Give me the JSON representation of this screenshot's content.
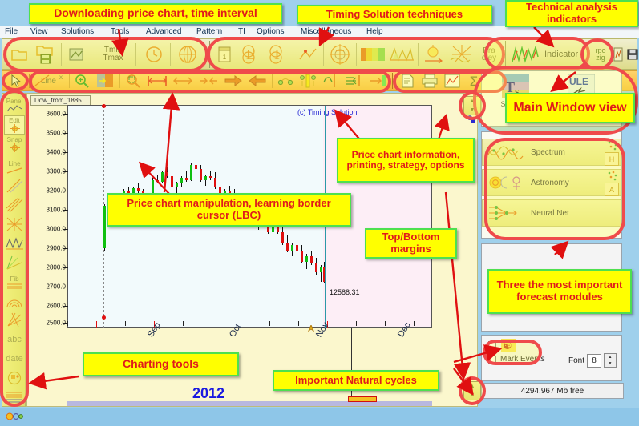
{
  "menu": {
    "items": [
      "File",
      "View",
      "Solutions",
      "Tools",
      "Advanced",
      "Pattern",
      "TI",
      "Options",
      "Miscellaneous",
      "Help"
    ]
  },
  "toolbar_main": {
    "buttons": [
      {
        "name": "open-chart",
        "icon": "folder-open-icon",
        "label": ""
      },
      {
        "name": "save-chart",
        "icon": "folder-save-icon",
        "label": ""
      },
      {
        "name": "export-icon",
        "icon": "export-icon",
        "label": ""
      },
      {
        "name": "time-interval",
        "icon": "tmin-tmax-icon",
        "label": "Tmin\nTmax"
      },
      {
        "name": "clock",
        "icon": "clock-icon",
        "label": ""
      },
      {
        "name": "globe",
        "icon": "globe-icon",
        "label": ""
      },
      {
        "name": "calendar",
        "icon": "calendar-icon",
        "label": ""
      },
      {
        "name": "overlap-e",
        "icon": "ellipse-e-icon",
        "label": ""
      },
      {
        "name": "overlap-t",
        "icon": "ellipse-t-icon",
        "label": ""
      },
      {
        "name": "scatter",
        "icon": "scatter-icon",
        "label": ""
      },
      {
        "name": "astro-wheel",
        "icon": "astro-wheel-icon",
        "label": ""
      },
      {
        "name": "color-bars",
        "icon": "color-bars-icon",
        "label": ""
      },
      {
        "name": "triangles",
        "icon": "triangle-wave-icon",
        "label": ""
      },
      {
        "name": "sun-arrow",
        "icon": "sun-arrow-icon",
        "label": ""
      },
      {
        "name": "star-burst",
        "icon": "star-burst-icon",
        "label": ""
      },
      {
        "name": "bradley",
        "icon": "bradley-icon",
        "label": "Bra\ndley"
      },
      {
        "name": "indicator",
        "icon": "indicator-icon",
        "label": "Indicator"
      },
      {
        "name": "rpo-zig",
        "icon": "zigzag-icon",
        "label": "rpo\nzig"
      },
      {
        "name": "composite",
        "icon": "composite-icon",
        "label": ""
      },
      {
        "name": "save-disk",
        "icon": "floppy-disk-icon",
        "label": ""
      }
    ]
  },
  "toolbar_chart": {
    "buttons": [
      {
        "name": "cursor-tool",
        "icon": "arrow-cursor-icon",
        "label": ""
      },
      {
        "name": "line-tool",
        "icon": "line-icon",
        "label": "Line"
      },
      {
        "name": "zoom-in",
        "icon": "magnifier-plus-icon",
        "label": ""
      },
      {
        "name": "border-cursor",
        "icon": "lbc-icon",
        "label": ""
      },
      {
        "name": "zoom-region",
        "icon": "magnifier-region-icon",
        "label": ""
      },
      {
        "name": "fit-width",
        "icon": "span-arrows-icon",
        "label": ""
      },
      {
        "name": "expand-x",
        "icon": "expand-arrows-icon",
        "label": ""
      },
      {
        "name": "shrink-x",
        "icon": "shrink-arrows-icon",
        "label": ""
      },
      {
        "name": "scroll-right",
        "icon": "arrow-right-icon",
        "label": ""
      },
      {
        "name": "scroll-left",
        "icon": "arrow-left-icon",
        "label": ""
      },
      {
        "name": "two-dots",
        "icon": "two-dots-icon",
        "label": ""
      },
      {
        "name": "split-view",
        "icon": "split-view-icon",
        "label": ""
      },
      {
        "name": "drag-edge",
        "icon": "hand-edge-icon",
        "label": ""
      },
      {
        "name": "snap-left",
        "icon": "snap-left-icon",
        "label": ""
      },
      {
        "name": "snap-right",
        "icon": "snap-right-icon",
        "label": ""
      },
      {
        "name": "chart-info",
        "icon": "document-icon",
        "label": ""
      },
      {
        "name": "print-chart",
        "icon": "printer-icon",
        "label": ""
      },
      {
        "name": "strategy",
        "icon": "strategy-chart-icon",
        "label": ""
      },
      {
        "name": "sum-options",
        "icon": "sigma-icon",
        "label": ""
      },
      {
        "name": "options-gear",
        "icon": "gear-icon",
        "label": ""
      }
    ]
  },
  "toolbar_left": {
    "buttons": [
      {
        "name": "panel-tool",
        "label": "Panel",
        "icon": "panel-icon"
      },
      {
        "name": "edit-tool",
        "label": "Edit",
        "icon": "edit-crosshair-icon"
      },
      {
        "name": "snap-tool",
        "label": "Snap",
        "icon": "snap-magnet-icon"
      },
      {
        "name": "line-tool",
        "label": "Line",
        "icon": "trend-line-icon"
      },
      {
        "name": "parallel-lines-tool",
        "label": "",
        "icon": "parallel-lines-icon"
      },
      {
        "name": "channel-tool",
        "label": "",
        "icon": "channel-icon"
      },
      {
        "name": "grid-tool",
        "label": "",
        "icon": "grid-lines-icon"
      },
      {
        "name": "zigzag-tool",
        "label": "",
        "icon": "zigzag-wave-icon"
      },
      {
        "name": "fan-tool",
        "label": "",
        "icon": "fan-lines-icon"
      },
      {
        "name": "fib-tool",
        "label": "Fib",
        "icon": "fibonacci-icon"
      },
      {
        "name": "fib-arc-tool",
        "label": "",
        "icon": "fib-arc-icon"
      },
      {
        "name": "fib-fan-tool",
        "label": "",
        "icon": "fib-fan-icon"
      },
      {
        "name": "text-tool",
        "label": "abc",
        "icon": "text-icon"
      },
      {
        "name": "date-tool",
        "label": "date",
        "icon": "date-icon"
      },
      {
        "name": "astro-tool",
        "label": "",
        "icon": "astro-face-icon"
      },
      {
        "name": "horizontal-lines-tool",
        "label": "",
        "icon": "horizontal-lines-icon"
      },
      {
        "name": "planet-tool",
        "label": "",
        "icon": "planets-icon"
      }
    ]
  },
  "chart": {
    "title": "Dow_from_1885...",
    "watermark": "(c) Timing Solution",
    "price_label": "12588.31",
    "year_label": "2012"
  },
  "chart_data": {
    "type": "line",
    "title": "Dow_from_1885...",
    "xlabel": "2012",
    "ylabel": "",
    "ylim": [
      2450,
      3650
    ],
    "ytick_values": [
      3600.0,
      3500.0,
      3400.0,
      3300.0,
      3200.0,
      3100.0,
      3000.0,
      2900.0,
      2800.0,
      2700.0,
      2600.0,
      2500.0
    ],
    "ytick_labels": [
      "3600.0",
      "3500.0",
      "3400.0",
      "3300.0",
      "3200.0",
      "3100.0",
      "3000.0",
      "2900.0",
      "2800.0",
      "2700.0",
      "2600.0",
      "2500.0"
    ],
    "xtick_labels": [
      "Sep",
      "Oct",
      "Nov",
      "Dec"
    ],
    "annotation_price": "12588.31",
    "grid": false,
    "legend": "none"
  },
  "right_panel": {
    "top_buttons": [
      {
        "name": "solutions-button",
        "label": "Solutions",
        "icon": "ts-solutions-icon"
      },
      {
        "name": "ule-button",
        "label": "ULE",
        "icon": "ule-icon"
      }
    ],
    "modules": [
      {
        "name": "spectrum-module",
        "label": "Spectrum",
        "icon": "spectrum-wave-icon",
        "badge": "H"
      },
      {
        "name": "astronomy-module",
        "label": "Astronomy",
        "icon": "astronomy-icon",
        "badge": "A"
      },
      {
        "name": "neural-net-module",
        "label": "Neural Net",
        "icon": "neural-net-icon",
        "badge": ""
      }
    ],
    "mark_events_label": "Mark Events",
    "font_label": "Font",
    "font_value": "8",
    "memory_status": "4294.967 Mb free"
  },
  "annotations": [
    {
      "name": "callout-downloading",
      "text": "Downloading price chart, time interval"
    },
    {
      "name": "callout-timing-solution",
      "text": "Timing Solution techniques"
    },
    {
      "name": "callout-technical-analysis",
      "text": "Technical analysis indicators"
    },
    {
      "name": "callout-main-window",
      "text": "Main Window view"
    },
    {
      "name": "callout-price-chart-info",
      "text": "Price chart information, printing, strategy, options"
    },
    {
      "name": "callout-chart-manipulation",
      "text": "Price chart manipulation, learning border cursor (LBC)"
    },
    {
      "name": "callout-top-bottom",
      "text": "Top/Bottom margins"
    },
    {
      "name": "callout-forecast-modules",
      "text": "Three the most important forecast modules"
    },
    {
      "name": "callout-charting-tools",
      "text": "Charting tools"
    },
    {
      "name": "callout-natural-cycles",
      "text": "Important Natural cycles"
    }
  ],
  "colors": {
    "callout_bg": "#ffff00",
    "callout_border": "#4ee04e",
    "callout_text": "#e01b1b",
    "highlight_ellipse": "#ef4b4b",
    "toolbar_yellow": "#e9e76a",
    "toolbar_orange": "#f6b63a"
  }
}
